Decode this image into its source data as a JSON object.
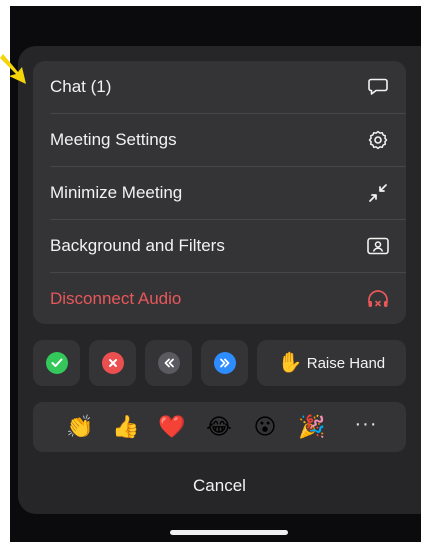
{
  "menu": {
    "items": [
      {
        "label": "Chat (1)",
        "icon": "chat-bubble-icon"
      },
      {
        "label": "Meeting Settings",
        "icon": "gear-icon"
      },
      {
        "label": "Minimize Meeting",
        "icon": "minimize-arrows-icon"
      },
      {
        "label": "Background and Filters",
        "icon": "portrait-frame-icon"
      },
      {
        "label": "Disconnect Audio",
        "icon": "headphones-disconnect-icon",
        "color": "#e8575a"
      }
    ]
  },
  "reactions": {
    "quick": [
      {
        "icon": "check-icon",
        "color": "#34c759"
      },
      {
        "icon": "x-icon",
        "color": "#eb4f4f"
      },
      {
        "icon": "slower-icon",
        "color": "#5a5a60"
      },
      {
        "icon": "faster-icon",
        "color": "#2d8cff"
      }
    ],
    "raise_hand": {
      "emoji": "✋",
      "label": "Raise Hand"
    },
    "emojis": [
      "👏",
      "👍",
      "❤️",
      "😂",
      "😮",
      "🎉"
    ],
    "more_label": "···"
  },
  "cancel_label": "Cancel",
  "colors": {
    "sheet_bg": "#262628",
    "card_bg": "#343436",
    "danger": "#e8575a",
    "arrow": "#f5d50a"
  }
}
